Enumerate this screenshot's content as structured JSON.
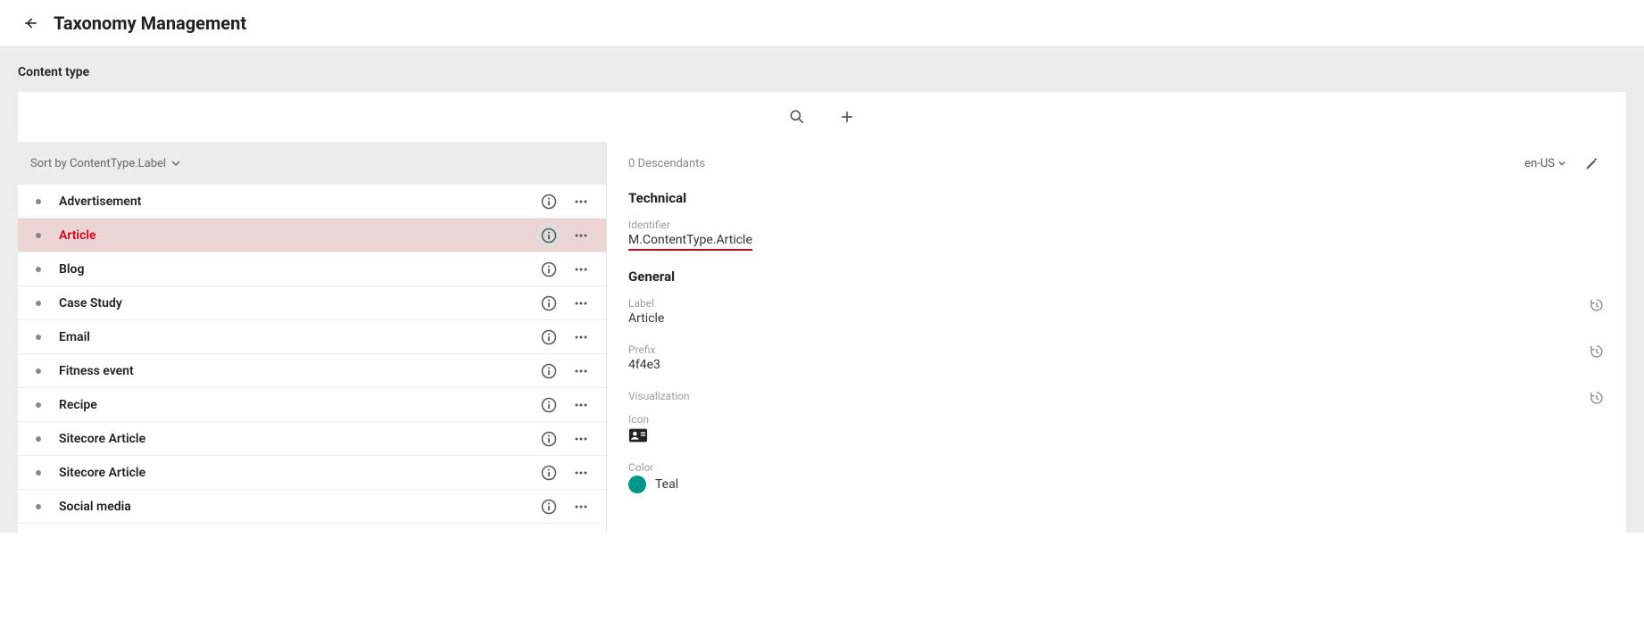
{
  "header": {
    "title": "Taxonomy Management"
  },
  "section": {
    "title": "Content type"
  },
  "sort": {
    "label": "Sort by ContentType.Label"
  },
  "list": {
    "items": [
      {
        "label": "Advertisement",
        "selected": false
      },
      {
        "label": "Article",
        "selected": true
      },
      {
        "label": "Blog",
        "selected": false
      },
      {
        "label": "Case Study",
        "selected": false
      },
      {
        "label": "Email",
        "selected": false
      },
      {
        "label": "Fitness event",
        "selected": false
      },
      {
        "label": "Recipe",
        "selected": false
      },
      {
        "label": "Sitecore Article",
        "selected": false
      },
      {
        "label": "Sitecore Article",
        "selected": false
      },
      {
        "label": "Social media",
        "selected": false
      }
    ]
  },
  "details": {
    "descendants": "0 Descendants",
    "language": "en-US",
    "technical_heading": "Technical",
    "identifier_label": "Identifier",
    "identifier_value": "M.ContentType.Article",
    "general_heading": "General",
    "label_label": "Label",
    "label_value": "Article",
    "prefix_label": "Prefix",
    "prefix_value": "4f4e3",
    "visualization_label": "Visualization",
    "icon_label": "Icon",
    "color_label": "Color",
    "color_value": "Teal",
    "color_hex": "#009688"
  }
}
